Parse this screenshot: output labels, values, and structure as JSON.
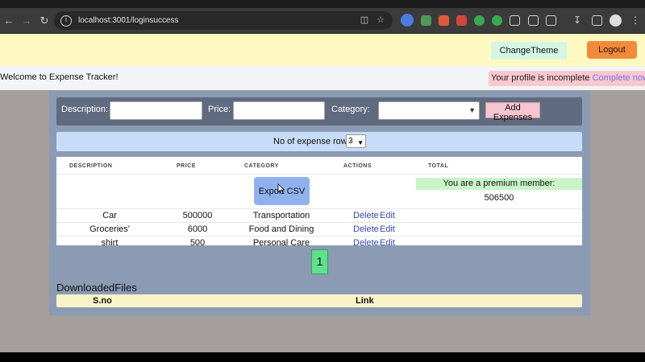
{
  "browser": {
    "url": "localhost:3001/loginsuccess",
    "icons": [
      "back-arrow-icon",
      "forward-arrow-icon",
      "reload-icon",
      "site-info-icon",
      "install-app-icon",
      "bookmark-star-icon",
      "extensions-icon",
      "download-icon",
      "sidebar-icon",
      "profile-avatar-icon"
    ]
  },
  "header": {
    "theme_label": "ChangeTheme",
    "logout_label": "Logout"
  },
  "welcome": {
    "text": "Welcome to Expense Tracker!",
    "profile_text": "Your profile is incomplete",
    "complete_link": "Complete now!"
  },
  "form": {
    "description_label": "Description:",
    "price_label": "Price:",
    "category_label": "Category:",
    "add_button": "Add Expenses"
  },
  "rows": {
    "label": "No of expense rows:",
    "value": "3"
  },
  "table": {
    "headers": [
      "DESCRIPTION",
      "PRICE",
      "CATEGORY",
      "ACTIONS",
      "TOTAL"
    ],
    "export_label": "Export CSV",
    "premium_text": "You are a premium member:",
    "total_value": "506500",
    "delete_label": "Delete",
    "edit_label": "Edit",
    "rows": [
      {
        "description": "Car",
        "price": "500000",
        "category": "Transportation"
      },
      {
        "description": "Groceries'",
        "price": "6000",
        "category": "Food and Dining"
      },
      {
        "description": "shirt",
        "price": "500",
        "category": "Personal Care"
      }
    ]
  },
  "pagination": {
    "page": "1"
  },
  "downloads": {
    "title": "DownloadedFiles",
    "col_sno": "S.no",
    "col_link": "Link"
  },
  "colors": {
    "header_bg": "#fdf9c0",
    "logout_bg": "#f28a3c",
    "theme_bg": "#d6f6e4",
    "container_bg": "#8b9bb4",
    "form_bg": "#606b80",
    "rows_bg": "#c7dcf8",
    "export_bg": "#8fb2ee",
    "premium_bg": "#c9f5c8",
    "page_btn_bg": "#5fe08a",
    "profile_bg": "#f9c9cf",
    "link_color": "#3a48a8"
  }
}
